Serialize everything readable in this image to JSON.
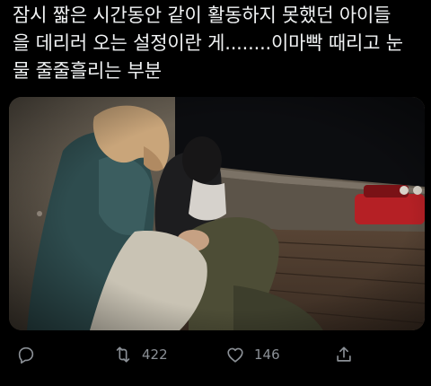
{
  "tweet": {
    "text": "잠시 짧은 시간동안 같이 활동하지 못했던 아이들\n을 데리러 오는 설정이란 게........이마빡 때리고 눈\n물 줄줄흘리는 부분"
  },
  "media": {
    "icon": "photo"
  },
  "actions": {
    "reply": {
      "icon": "reply-icon",
      "count": ""
    },
    "retweet": {
      "icon": "retweet-icon",
      "count": "422"
    },
    "like": {
      "icon": "heart-icon",
      "count": "146"
    },
    "share": {
      "icon": "share-icon",
      "count": ""
    }
  },
  "colors": {
    "background": "#000000",
    "text": "#f0f2f3",
    "icon": "#8b9096"
  }
}
